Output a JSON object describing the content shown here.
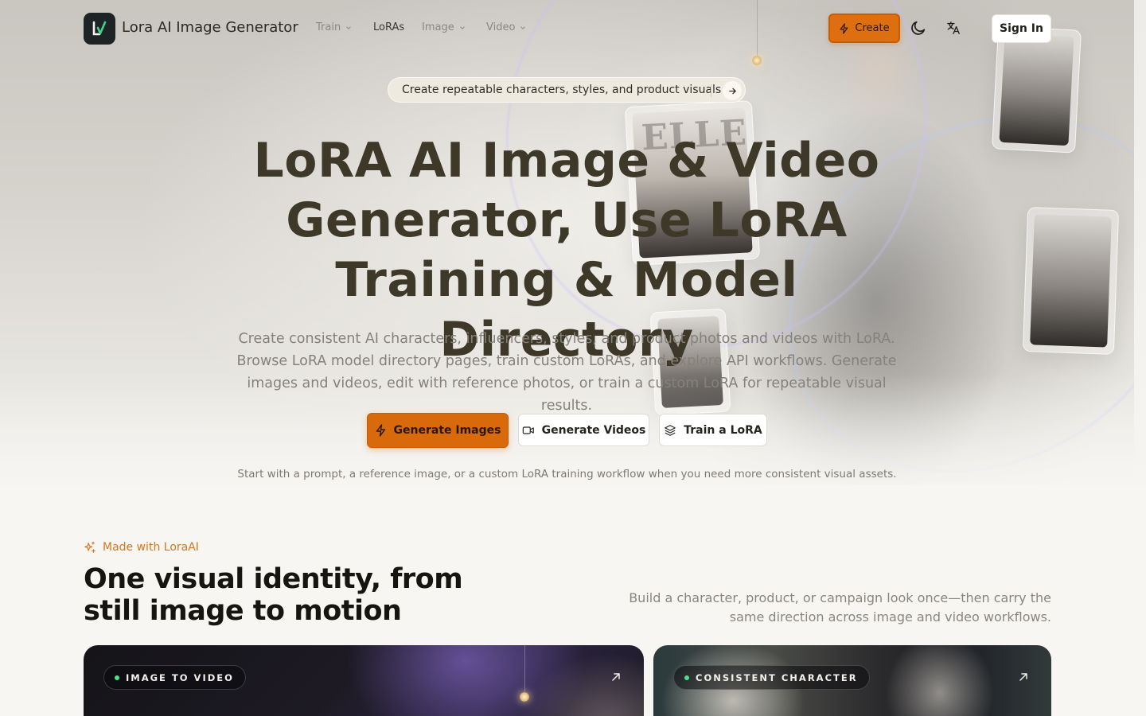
{
  "nav": {
    "brand": "Lora AI Image Generator",
    "items": [
      {
        "label": "Train",
        "has_menu": true
      },
      {
        "label": "LoRAs",
        "has_menu": false
      },
      {
        "label": "Image",
        "has_menu": true
      },
      {
        "label": "Video",
        "has_menu": true
      }
    ],
    "create_label": "Create",
    "signin_label": "Sign In",
    "icons": {
      "logo": "lora-logo-icon",
      "create": "lightning-icon",
      "theme": "moon-icon",
      "language": "translate-icon",
      "chevron": "chevron-down-icon"
    }
  },
  "hero": {
    "announcement": "Create repeatable characters, styles, and product visuals",
    "magazine_text": "ELLE",
    "title": "LoRA AI Image & Video Generator, Use LoRA Training & Model Directory",
    "description": "Create consistent AI characters, influencers, styles, and product photos and videos with LoRA. Browse LoRA model directory pages, train custom LoRAs, and explore API workflows. Generate images and videos, edit with reference photos, or train a custom LoRA for repeatable visual results.",
    "cta": {
      "generate_images": "Generate Images",
      "generate_videos": "Generate Videos",
      "train_lora": "Train a LoRA"
    },
    "note": "Start with a prompt, a reference image, or a custom LoRA training workflow when you need more consistent visual assets."
  },
  "section": {
    "tag": "Made with LoraAI",
    "title": "One visual identity, from still image to motion",
    "description": "Build a character, product, or campaign look once—then carry the same direction across image and video workflows.",
    "cards": [
      {
        "label": "IMAGE TO VIDEO"
      },
      {
        "label": "CONSISTENT CHARACTER"
      }
    ]
  },
  "colors": {
    "accent": "#d86a0b",
    "accent_text": "#d4761f",
    "headline": "#3d3828",
    "status_dot": "#4ee08a"
  }
}
